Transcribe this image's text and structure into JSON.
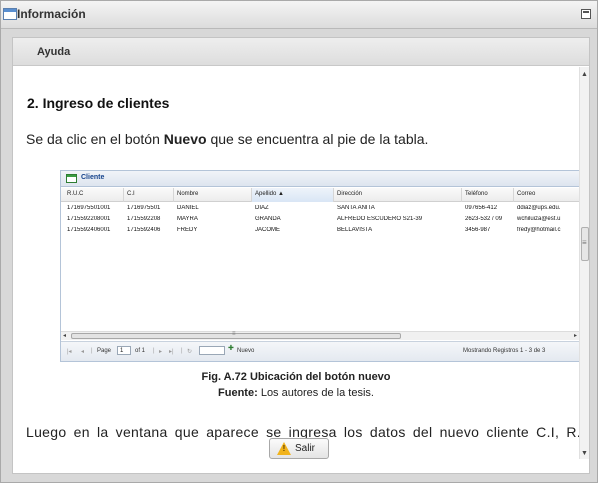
{
  "window": {
    "title": "Información"
  },
  "panel": {
    "title": "Ayuda"
  },
  "document": {
    "heading": "2. Ingreso de clientes",
    "para1_pre": "Se da clic en el botón ",
    "para1_bold": "Nuevo",
    "para1_post": " que se encuentra al pie de la tabla.",
    "caption1": "Fig. A.72 Ubicación del botón nuevo",
    "caption2_bold": "Fuente:",
    "caption2_rest": " Los autores de la tesis.",
    "para2": "Luego en la ventana que aparece se ingresa los datos del nuevo cliente C.I, R.U.C"
  },
  "grid": {
    "title": "Cliente",
    "columns": [
      "R.U.C",
      "C.I",
      "Nombre",
      "Apellido ▲",
      "Dirección",
      "Teléfono",
      "Correo"
    ],
    "rows": [
      [
        "1716975501001",
        "1716975501",
        "DANIEL",
        "DIAZ",
        "SANTA ANITA",
        "097656-412",
        "ddiaz@ups.edu."
      ],
      [
        "1715592208001",
        "1715592208",
        "MAYRA",
        "GRANDA",
        "ALFREDO ESCUDERO S21-39",
        "2623-532 / 09",
        "wchiluiza@est.u"
      ],
      [
        "1715592406001",
        "1715592406",
        "FREDY",
        "JACOME",
        "BELLAVISTA",
        "3456-987",
        "fredy@hotmail.c"
      ]
    ],
    "paging": {
      "page_label": "Page",
      "page_value": "1",
      "of_label": "of 1",
      "nuevo_label": "Nuevo",
      "status": "Mostrando Registros 1 - 3 de 3"
    }
  },
  "footer": {
    "salir_label": "Salir"
  }
}
